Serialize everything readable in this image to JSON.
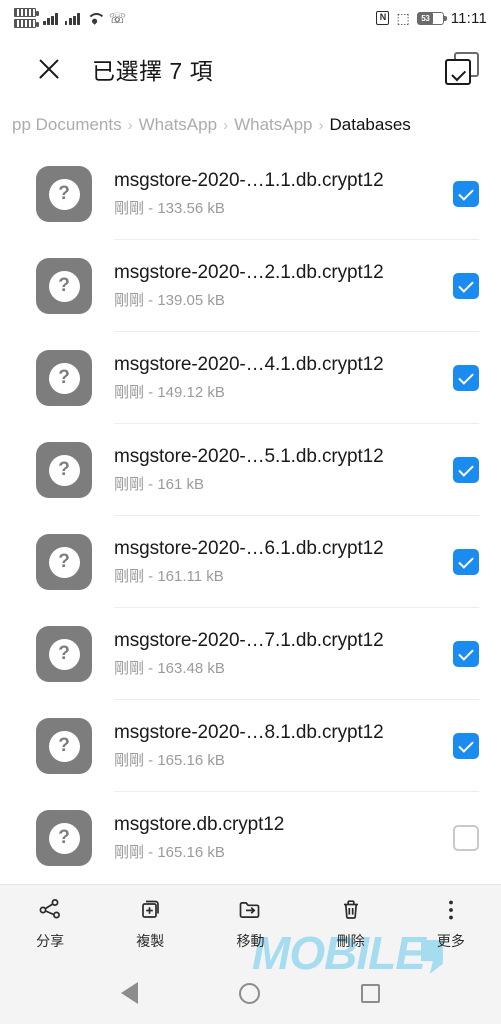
{
  "statusbar": {
    "sim1_icon": "sim-signal-icon",
    "sim2_icon": "sim-signal-icon",
    "signal1_icon": "cellular-signal-icon",
    "signal2_icon": "cellular-signal-icon",
    "wifi_icon": "wifi-icon",
    "call_icon": "phone-call-icon",
    "nfc_icon": "nfc-icon",
    "nfc_glyph": "N",
    "bluetooth_icon": "bluetooth-icon",
    "bluetooth_glyph": "✶",
    "battery_icon": "battery-icon",
    "battery_level": "53",
    "time": "11:11"
  },
  "appbar": {
    "close_icon": "close-icon",
    "title": "已選擇 7 項",
    "select_all_icon": "select-all-icon"
  },
  "breadcrumb": {
    "separator": "›",
    "items": [
      {
        "label": "pp Documents",
        "active": false
      },
      {
        "label": "WhatsApp",
        "active": false
      },
      {
        "label": "WhatsApp",
        "active": false
      },
      {
        "label": "Databases",
        "active": true
      }
    ]
  },
  "filelist": {
    "icon_glyph": "?",
    "icon_name": "unknown-file-icon",
    "rows": [
      {
        "name": "msgstore-2020-…1.1.db.crypt12",
        "sub": "剛剛 - 133.56 kB",
        "checked": true
      },
      {
        "name": "msgstore-2020-…2.1.db.crypt12",
        "sub": "剛剛 - 139.05 kB",
        "checked": true
      },
      {
        "name": "msgstore-2020-…4.1.db.crypt12",
        "sub": "剛剛 - 149.12 kB",
        "checked": true
      },
      {
        "name": "msgstore-2020-…5.1.db.crypt12",
        "sub": "剛剛 - 161 kB",
        "checked": true
      },
      {
        "name": "msgstore-2020-…6.1.db.crypt12",
        "sub": "剛剛 - 161.11 kB",
        "checked": true
      },
      {
        "name": "msgstore-2020-…7.1.db.crypt12",
        "sub": "剛剛 - 163.48 kB",
        "checked": true
      },
      {
        "name": "msgstore-2020-…8.1.db.crypt12",
        "sub": "剛剛 - 165.16 kB",
        "checked": true
      },
      {
        "name": "msgstore.db.crypt12",
        "sub": "剛剛 - 165.16 kB",
        "checked": false
      }
    ]
  },
  "toolbar": {
    "items": [
      {
        "label": "分享",
        "icon": "share-icon"
      },
      {
        "label": "複製",
        "icon": "copy-icon"
      },
      {
        "label": "移動",
        "icon": "move-folder-icon"
      },
      {
        "label": "刪除",
        "icon": "trash-icon"
      },
      {
        "label": "更多",
        "icon": "more-vertical-icon"
      }
    ]
  },
  "watermark": {
    "text": "MOBILE"
  },
  "navbar": {
    "back_icon": "nav-back-icon",
    "home_icon": "nav-home-icon",
    "recents_icon": "nav-recents-icon"
  },
  "colors": {
    "accent": "#1a8cf0",
    "file_icon": "#7d7d7d",
    "watermark": "#a6dcef",
    "toolbar_bg": "#f4f4f4"
  }
}
